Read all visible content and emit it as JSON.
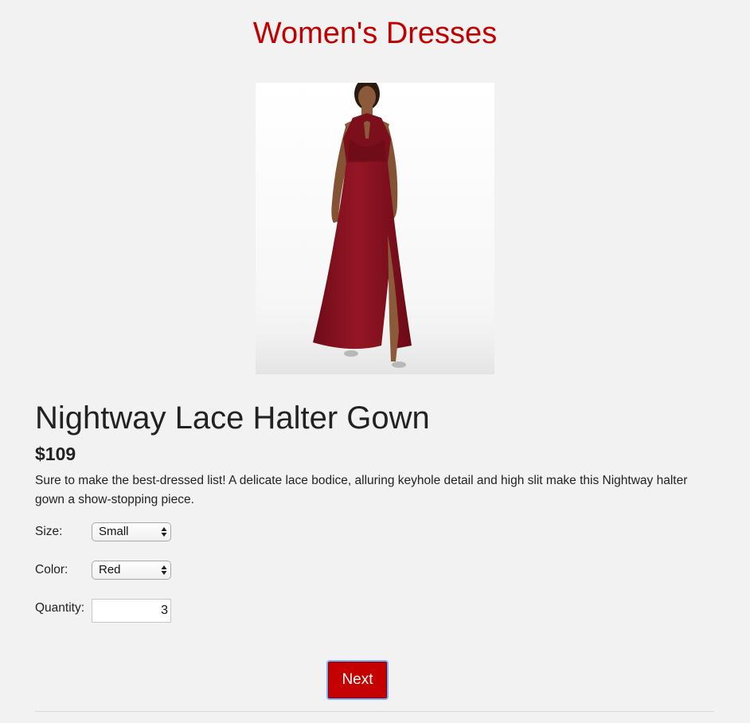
{
  "header": {
    "title": "Women's Dresses"
  },
  "product": {
    "image_alt": "Woman wearing a burgundy lace halter gown",
    "name": "Nightway Lace Halter Gown",
    "price": "$109",
    "description": "Sure to make the best-dressed list! A delicate lace bodice, alluring keyhole detail and high slit make this Nightway halter gown a show-stopping piece."
  },
  "form": {
    "size": {
      "label": "Size:",
      "value": "Small"
    },
    "color": {
      "label": "Color:",
      "value": "Red"
    },
    "quantity": {
      "label": "Quantity:",
      "value": "3"
    }
  },
  "actions": {
    "next_label": "Next"
  },
  "colors": {
    "accent": "#c00000",
    "dress": "#8b1220",
    "background": "#f2f2f2"
  }
}
